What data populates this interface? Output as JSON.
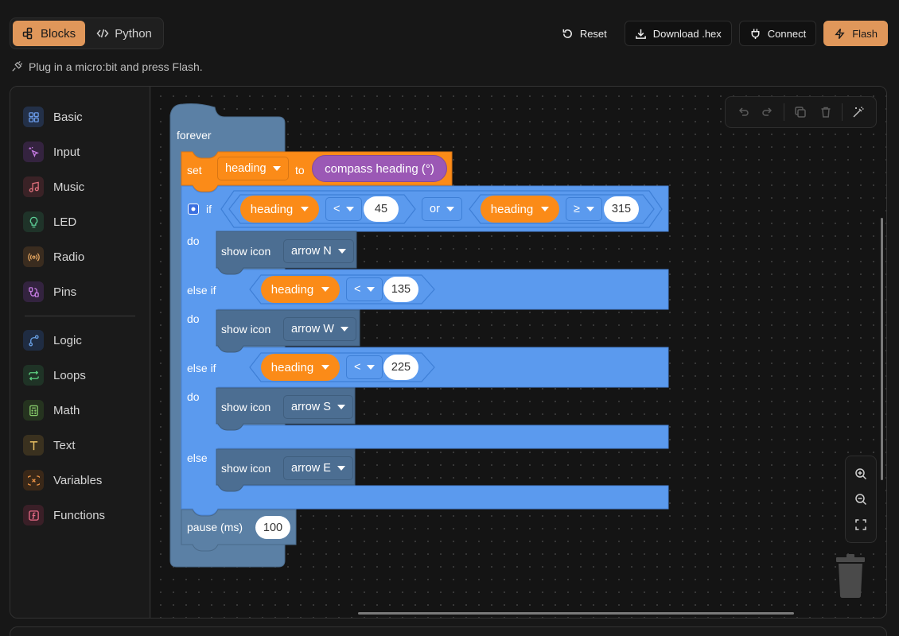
{
  "mode_toggle": {
    "blocks_label": "Blocks",
    "python_label": "Python",
    "active": "blocks"
  },
  "actions": {
    "reset": "Reset",
    "download": "Download .hex",
    "connect": "Connect",
    "flash": "Flash"
  },
  "hint": "Plug in a micro:bit and press Flash.",
  "categories": [
    {
      "label": "Basic",
      "icon": "grid-icon",
      "color": "#4a7fd6"
    },
    {
      "label": "Input",
      "icon": "sparkle-cursor-icon",
      "color": "#b05bd1"
    },
    {
      "label": "Music",
      "icon": "music-note-icon",
      "color": "#d64a5a"
    },
    {
      "label": "LED",
      "icon": "lightbulb-icon",
      "color": "#3fb07a"
    },
    {
      "label": "Radio",
      "icon": "radio-waves-icon",
      "color": "#d98c3a"
    },
    {
      "label": "Pins",
      "icon": "pins-icon",
      "color": "#b04ad6"
    },
    {
      "label": "Logic",
      "icon": "branch-icon",
      "color": "#4a8ad6"
    },
    {
      "label": "Loops",
      "icon": "loop-arrows-icon",
      "color": "#3fbf6a"
    },
    {
      "label": "Math",
      "icon": "calculator-icon",
      "color": "#5fb04a"
    },
    {
      "label": "Text",
      "icon": "text-t-icon",
      "color": "#d6a23a"
    },
    {
      "label": "Variables",
      "icon": "variable-icon",
      "color": "#e0782a"
    },
    {
      "label": "Functions",
      "icon": "function-icon",
      "color": "#d64a6a"
    }
  ],
  "program": {
    "forever": "forever",
    "set_kw": "set",
    "set_var": "heading",
    "to_kw": "to",
    "compass": "compass heading (°)",
    "if_kw": "if",
    "do_kw": "do",
    "else_if_kw": "else if",
    "else_kw": "else",
    "or_kw": "or",
    "var": "heading",
    "op_lt": "<",
    "op_ge": "≥",
    "cond1_value": "45",
    "cond2_value": "315",
    "cond3_value": "135",
    "cond4_value": "225",
    "show_icon": "show icon",
    "icon_n": "arrow N",
    "icon_w": "arrow W",
    "icon_s": "arrow S",
    "icon_e": "arrow E",
    "pause_label": "pause (ms)",
    "pause_value": "100"
  },
  "colors": {
    "accent": "#e0975a",
    "loops": "#5b80a5",
    "logic": "#5b9aee",
    "variables": "#fb8b18",
    "basic_show": "#4c6e92",
    "input_purple": "#9b58b5"
  }
}
